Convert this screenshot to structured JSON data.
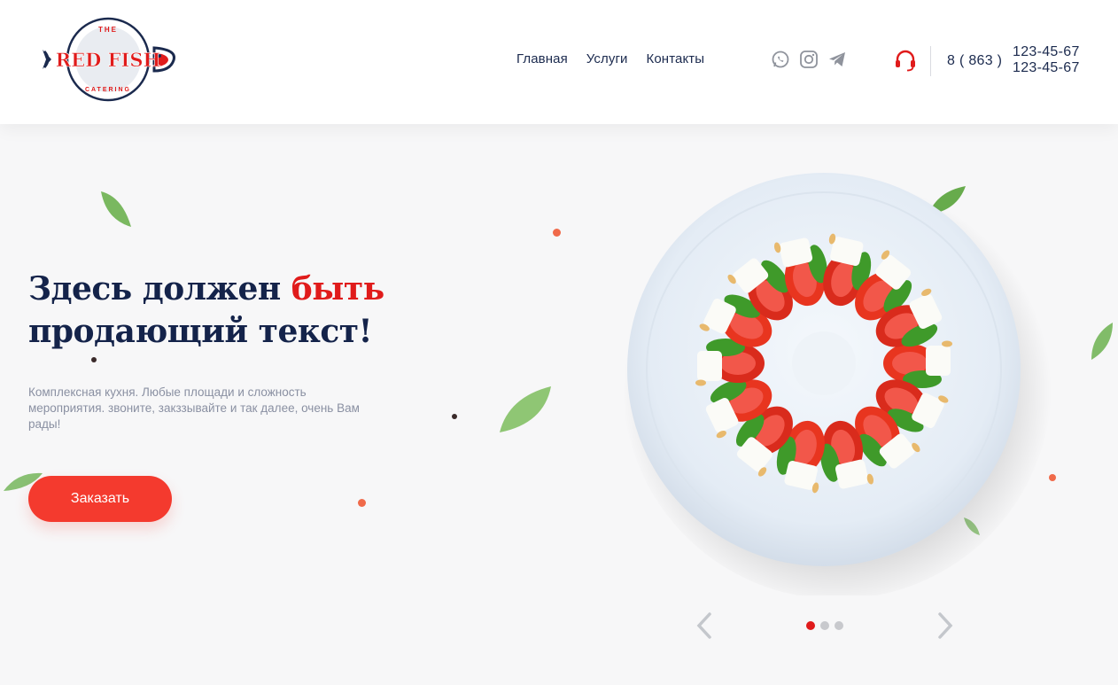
{
  "brand": {
    "top_word": "THE",
    "name": "RED FISH",
    "bottom_word": "CATERING",
    "colors": {
      "navy": "#1b2a4e",
      "red": "#e01b1b",
      "button": "#f43a2e"
    }
  },
  "nav": {
    "items": [
      {
        "label": "Главная"
      },
      {
        "label": "Услуги"
      },
      {
        "label": "Контакты"
      }
    ]
  },
  "socials": [
    "whatsapp-icon",
    "instagram-icon",
    "telegram-icon"
  ],
  "contact": {
    "icon": "headset-icon",
    "code": "8 ( 863 )",
    "phones": [
      "123-45-67",
      "123-45-67"
    ]
  },
  "hero": {
    "headline_part1": "Здесь должен ",
    "headline_accent": "быть",
    "headline_part2": "продающий текст!",
    "description": "Комплексная кухня. Любые площади и сложность мероприятия. звоните, закззывайте и так далее, очень Вам рады!",
    "button_label": "Заказать"
  },
  "slider": {
    "prev_icon": "chevron-left-icon",
    "next_icon": "chevron-right-icon",
    "slide_count": 3,
    "active_index": 0
  }
}
